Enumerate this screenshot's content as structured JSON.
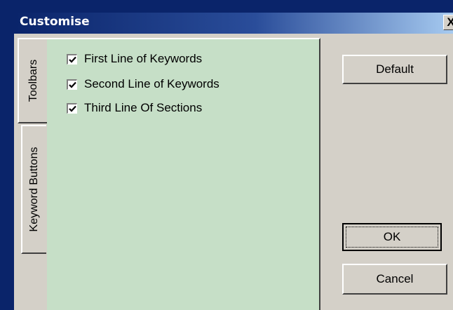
{
  "dialog": {
    "title": "Customise",
    "close_label": "X"
  },
  "tabs": [
    {
      "label": "Toolbars",
      "selected": true
    },
    {
      "label": "Keyword Buttons",
      "selected": false
    }
  ],
  "options": [
    {
      "label": "First Line of Keywords",
      "checked": true
    },
    {
      "label": "Second Line of Keywords",
      "checked": true
    },
    {
      "label": "Third Line Of Sections",
      "checked": true
    }
  ],
  "buttons": {
    "default_label": "Default",
    "ok_label": "OK",
    "cancel_label": "Cancel"
  },
  "colors": {
    "title_bar": "#0a246a",
    "panel_background": "#c6dfc7",
    "dialog_face": "#d4d0c8"
  }
}
